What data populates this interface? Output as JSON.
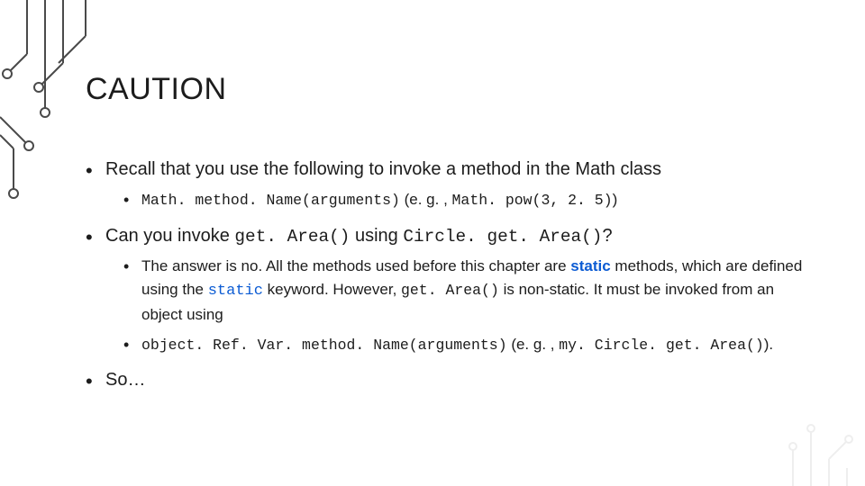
{
  "title": "CAUTION",
  "bullets": {
    "b1": {
      "text": "Recall that you use the following to invoke a method in the Math class",
      "sub1_code": "Math. method. Name(arguments)",
      "sub1_mid": " (e. g. , ",
      "sub1_code2": "Math. pow(3, 2. 5)",
      "sub1_end": ")"
    },
    "b2": {
      "pre": "Can you invoke ",
      "code1": "get. Area()",
      "mid1": " using ",
      "code2": "Circle. get. Area()",
      "post": "?",
      "sub1_a": "The answer is no. All the methods used before this chapter are ",
      "sub1_static": "static",
      "sub1_b": " methods, which are defined using the ",
      "sub1_statickw": "static",
      "sub1_c": " keyword. However, ",
      "sub1_code": "get. Area()",
      "sub1_d": " is non-static. It must be invoked from an object using",
      "sub2_code": "object. Ref. Var. method. Name(arguments)",
      "sub2_mid": " (e. g. , ",
      "sub2_code2": "my. Circle. get. Area()",
      "sub2_end": ")."
    },
    "b3": "So…"
  }
}
